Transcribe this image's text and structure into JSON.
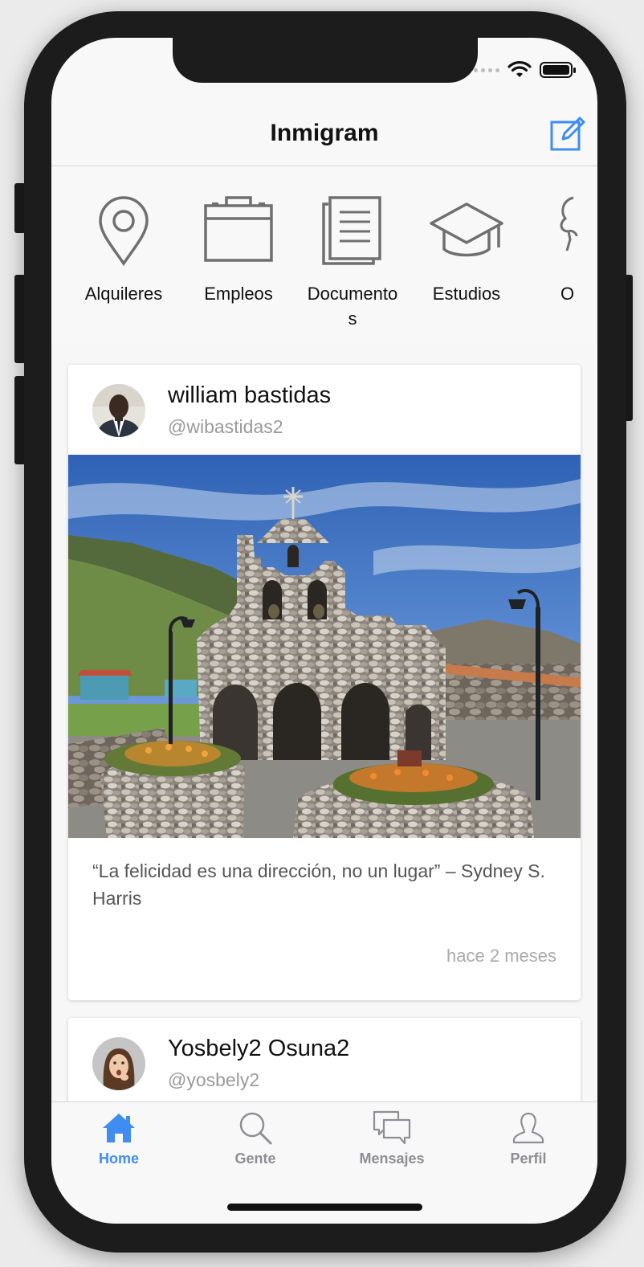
{
  "app": {
    "title": "Inmigram"
  },
  "categories": [
    {
      "label": "Alquileres",
      "icon": "location-pin-icon"
    },
    {
      "label": "Empleos",
      "icon": "briefcase-icon"
    },
    {
      "label": "Documentos",
      "icon": "documents-icon"
    },
    {
      "label": "Estudios",
      "icon": "graduation-cap-icon"
    },
    {
      "label": "O",
      "icon": "other-icon"
    }
  ],
  "posts": [
    {
      "name": "william bastidas",
      "handle": "@wibastidas2",
      "caption": "“La felicidad es una dirección, no un lugar” – Sydney S. Harris",
      "time": "hace 2 meses"
    },
    {
      "name": "Yosbely2 Osuna2",
      "handle": "@yosbely2"
    }
  ],
  "tabs": [
    {
      "label": "Home",
      "icon": "home-icon",
      "active": true
    },
    {
      "label": "Gente",
      "icon": "search-icon",
      "active": false
    },
    {
      "label": "Mensajes",
      "icon": "chat-bubbles-icon",
      "active": false
    },
    {
      "label": "Perfil",
      "icon": "person-icon",
      "active": false
    }
  ],
  "colors": {
    "accent": "#3f8cf3",
    "icon_gray": "#6f6f6f",
    "inactive_tab": "#8e8e93"
  }
}
